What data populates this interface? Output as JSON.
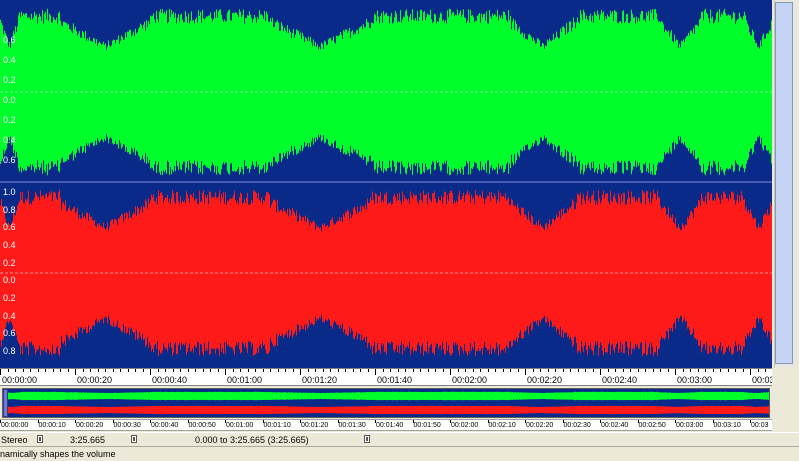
{
  "waveform": {
    "channels": [
      {
        "name": "left",
        "color": "#00ff2a"
      },
      {
        "name": "right",
        "color": "#ff1a1a"
      }
    ],
    "background_color": "#0a2a8a",
    "amp_labels_top": [
      "0.6",
      "0.4",
      "0.2",
      "0.0",
      "0.2",
      "0.4",
      "0.6"
    ],
    "amp_labels_bottom": [
      "1.0",
      "0.8",
      "0.6",
      "0.4",
      "0.2",
      "0.0",
      "0.2",
      "0.4",
      "0.6",
      "0.8"
    ]
  },
  "time_ruler": {
    "labels": [
      "00:00:00",
      "00:00:20",
      "00:00:40",
      "00:01:00",
      "00:01:20",
      "00:01:40",
      "00:02:00",
      "00:02:20",
      "00:02:40",
      "00:03:00",
      "00:03"
    ]
  },
  "overview_ruler": {
    "labels": [
      "00:00:00",
      "00:00:10",
      "00:00:20",
      "00:00:30",
      "00:00:40",
      "00:00:50",
      "00:01:00",
      "00:01:10",
      "00:01:20",
      "00:01:30",
      "00:01:40",
      "00:01:50",
      "00:02:00",
      "00:02:10",
      "00:02:20",
      "00:02:30",
      "00:02:40",
      "00:02:50",
      "00:03:00",
      "00:03:10",
      "00:03"
    ]
  },
  "status": {
    "channel_mode": "Stereo",
    "length": "3:25.665",
    "selection": "0.000 to 3:25.665 (3:25.665)"
  },
  "hint": {
    "text": "namically shapes the volume"
  }
}
